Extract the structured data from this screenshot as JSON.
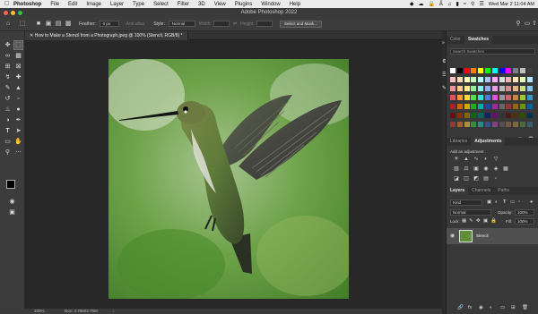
{
  "menubar": {
    "app_name": "Photoshop",
    "items": [
      "File",
      "Edit",
      "Image",
      "Layer",
      "Type",
      "Select",
      "Filter",
      "3D",
      "View",
      "Plugins",
      "Window",
      "Help"
    ],
    "clock": "Wed Mar 2  11:04 AM"
  },
  "window": {
    "title": "Adobe Photoshop 2022"
  },
  "options_bar": {
    "feather_label": "Feather:",
    "feather_value": "0 px",
    "antialias_label": "Anti-alias",
    "style_label": "Style:",
    "style_value": "Normal",
    "width_label": "Width:",
    "height_label": "Height:",
    "select_mask_label": "Select and Mask..."
  },
  "document": {
    "tab_title": "How to Make a Stencil from a Photograph.jpeg @ 100% (Stencil, RGB/8) *",
    "zoom": "100%",
    "doc_size": "Doc: 4.75M/4.75M"
  },
  "panels": {
    "color_tabs": [
      "Color",
      "Swatches"
    ],
    "swatch_search_placeholder": "Search Swatches",
    "adjust_tabs": [
      "Libraries",
      "Adjustments"
    ],
    "adjust_hint": "Add an adjustment",
    "layers_tabs": [
      "Layers",
      "Channels",
      "Paths"
    ],
    "kind_value": "Kind",
    "blend_mode": "Normal",
    "opacity_label": "Opacity:",
    "opacity_value": "100%",
    "lock_label": "Lock:",
    "fill_label": "Fill:",
    "fill_value": "100%",
    "layer_name": "Stencil"
  },
  "swatch_colors": [
    [
      "#ffffff",
      "#000000",
      "#fd0000",
      "#fe7f00",
      "#ffff00",
      "#00ff00",
      "#00ffff",
      "#0000ff",
      "#ff00ff",
      "#7f7f7f",
      "#c0c0c0",
      "#404040"
    ],
    [
      "#fec0c0",
      "#ffd9b3",
      "#ffffb3",
      "#c0ffc0",
      "#b3ffff",
      "#b3c0ff",
      "#ffb3ff",
      "#dddddd",
      "#f2b3b3",
      "#ffe6b3",
      "#e6ffb3",
      "#b3e6ff"
    ],
    [
      "#ee9999",
      "#ffcc88",
      "#ffee88",
      "#99ee99",
      "#88eeee",
      "#99aaee",
      "#ee99ee",
      "#bbbbbb",
      "#d98c8c",
      "#e6b880",
      "#c8e680",
      "#80c8e6"
    ],
    [
      "#dd5555",
      "#ff9933",
      "#ffdd33",
      "#55dd55",
      "#33dddd",
      "#5577dd",
      "#dd55dd",
      "#999999",
      "#cc6666",
      "#cc8833",
      "#99cc33",
      "#3399cc"
    ],
    [
      "#aa2222",
      "#cc6600",
      "#ccaa00",
      "#22aa22",
      "#00aaaa",
      "#2244aa",
      "#aa22aa",
      "#666666",
      "#993333",
      "#996600",
      "#669900",
      "#006699"
    ],
    [
      "#661111",
      "#803300",
      "#806600",
      "#116611",
      "#006666",
      "#112266",
      "#661166",
      "#333333",
      "#4d1a1a",
      "#4d3300",
      "#334d00",
      "#00334d"
    ],
    [
      "#8a3c3c",
      "#a0602a",
      "#a89038",
      "#3c8a3c",
      "#2a8a8a",
      "#3c4e8a",
      "#8a3c8a",
      "#505050",
      "#6e5a46",
      "#7a6a3c",
      "#4e6a3c",
      "#3c5a6e"
    ]
  ]
}
